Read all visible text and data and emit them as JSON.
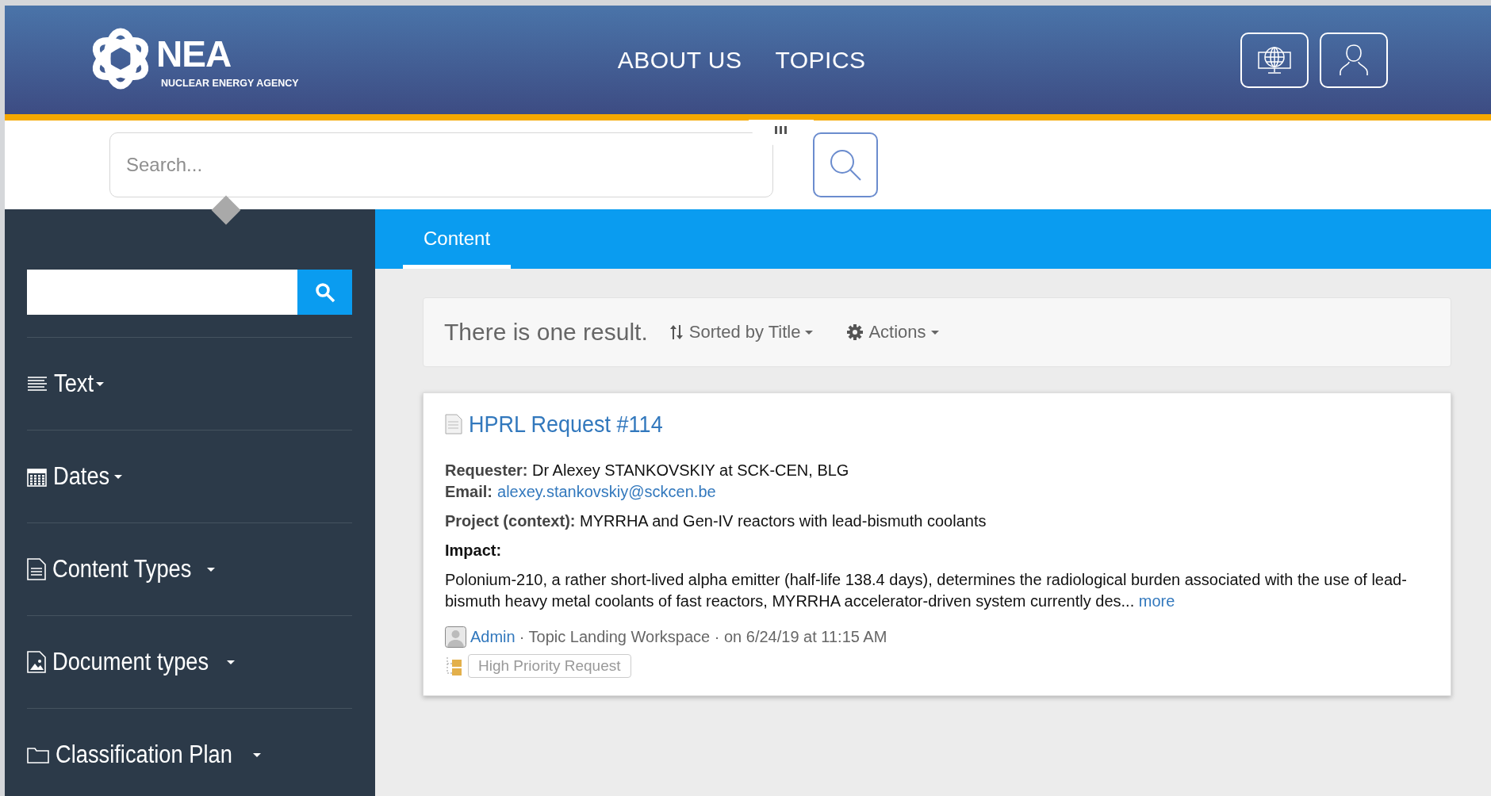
{
  "header": {
    "logo": {
      "name": "NEA",
      "subtitle": "NUCLEAR ENERGY AGENCY"
    },
    "nav": [
      "ABOUT US",
      "TOPICS"
    ]
  },
  "search": {
    "placeholder": "Search..."
  },
  "sidebar": {
    "facets": [
      {
        "label": "Text",
        "kind": "text"
      },
      {
        "label": "Dates",
        "kind": "dates"
      },
      {
        "label": "Content Types",
        "kind": "content"
      },
      {
        "label": "Document types",
        "kind": "document"
      },
      {
        "label": "Classification Plan",
        "kind": "folder"
      }
    ]
  },
  "tabs": [
    {
      "label": "Content",
      "selected": true
    }
  ],
  "results": {
    "summary": "There is one result.",
    "sort": "Sorted by Title",
    "actions": "Actions"
  },
  "result": {
    "title": "HPRL Request #114",
    "requester": "**Requester:** Dr Alexey STANKOVSKIY at SCK-CEN, BLG",
    "email": {
      "label": "Email:",
      "value": "alexey.stankovskiy@sckcen.be"
    },
    "project": "**Project (context):** MYRRHA and Gen-IV reactors with lead-bismuth coolants",
    "impact": {
      "label": "Impact:",
      "text": "Polonium-210, a rather short-lived alpha emitter (half-life 138.4 days), determines the radiological burden associated with the use of lead-bismuth heavy metal coolants of fast reactors, MYRRHA accelerator-driven system currently des...",
      "more": "more"
    },
    "meta": {
      "author": "Admin",
      "details": "· Topic Landing Workspace · on 6/24/19 at 11:15 AM"
    },
    "tags": [
      "High Priority Request"
    ]
  }
}
